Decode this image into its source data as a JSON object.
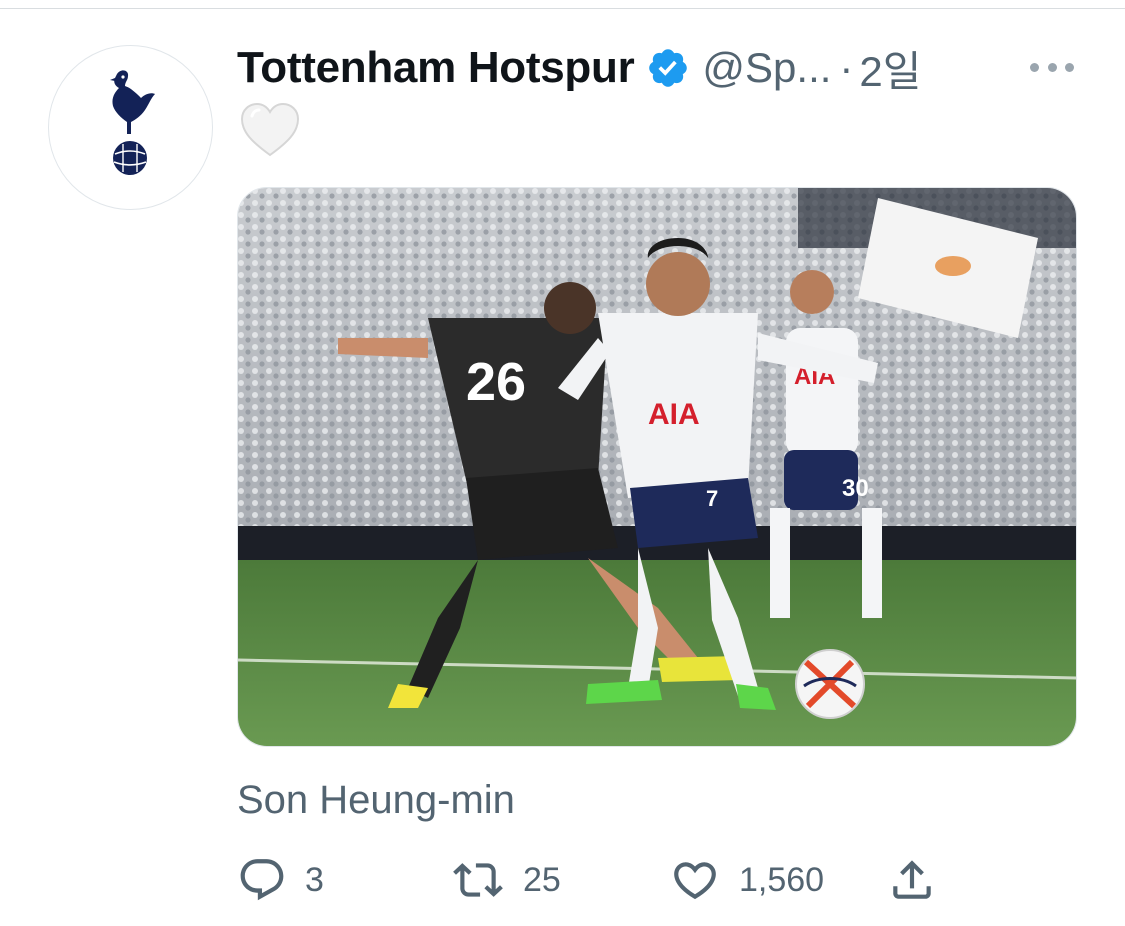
{
  "tweet": {
    "author": {
      "display_name": "Tottenham Hotspur",
      "handle": "@Sp...",
      "verified": true,
      "avatar_icon": "cockerel-crest-icon"
    },
    "separator": "·",
    "time": "2일",
    "emoji": "white-heart-icon",
    "media": {
      "image": "football-match-photo",
      "jersey_texts": [
        "AIA",
        "AIA",
        "26",
        "7",
        "30"
      ]
    },
    "caption": "Son Heung-min",
    "actions": {
      "reply": {
        "icon": "reply-icon",
        "count": "3"
      },
      "retweet": {
        "icon": "retweet-icon",
        "count": "25"
      },
      "like": {
        "icon": "heart-outline-icon",
        "count": "1,560"
      },
      "share": {
        "icon": "share-icon"
      }
    }
  },
  "colors": {
    "text_primary": "#0f1419",
    "text_secondary": "#536471",
    "verified_blue": "#1d9bf0",
    "spurs_navy": "#132257"
  }
}
